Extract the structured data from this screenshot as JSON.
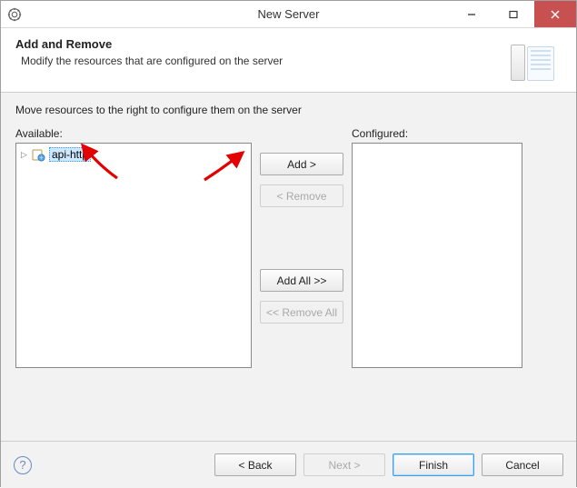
{
  "window": {
    "title": "New Server"
  },
  "banner": {
    "title": "Add and Remove",
    "description": "Modify the resources that are configured on the server"
  },
  "content": {
    "instruction": "Move resources to the right to configure them on the server",
    "available_label": "Available:",
    "configured_label": "Configured:",
    "available_items": [
      {
        "label": "api-http",
        "selected": true
      }
    ],
    "configured_items": []
  },
  "buttons": {
    "add": "Add >",
    "remove": "< Remove",
    "add_all": "Add All >>",
    "remove_all": "<< Remove All"
  },
  "footer": {
    "back": "< Back",
    "next": "Next >",
    "finish": "Finish",
    "cancel": "Cancel"
  }
}
